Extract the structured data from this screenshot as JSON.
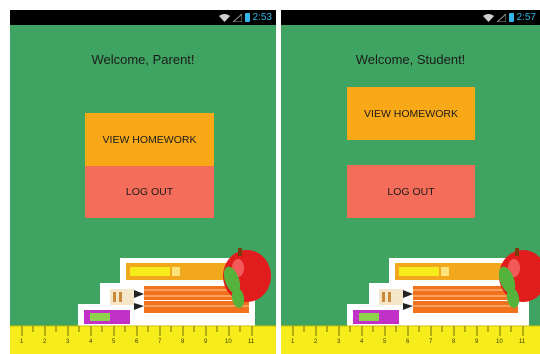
{
  "status_bar": {
    "left_time": "2:53",
    "right_time": "2:57"
  },
  "parent_screen": {
    "welcome": "Welcome, Parent!",
    "view_homework": "VIEW HOMEWORK",
    "log_out": "LOG OUT"
  },
  "student_screen": {
    "welcome": "Welcome, Student!",
    "view_homework": "VIEW HOMEWORK",
    "log_out": "LOG OUT"
  },
  "ruler_numbers": [
    "1",
    "2",
    "3",
    "4",
    "5",
    "6",
    "7",
    "8",
    "9",
    "10",
    "11"
  ],
  "colors": {
    "background": "#3fa462",
    "view_homework": "#f9a818",
    "log_out": "#f46c5a",
    "status_accent": "#33b5e5",
    "ruler": "#f6ec1c"
  },
  "icons": [
    "wifi-icon",
    "signal-icon",
    "battery-icon"
  ]
}
